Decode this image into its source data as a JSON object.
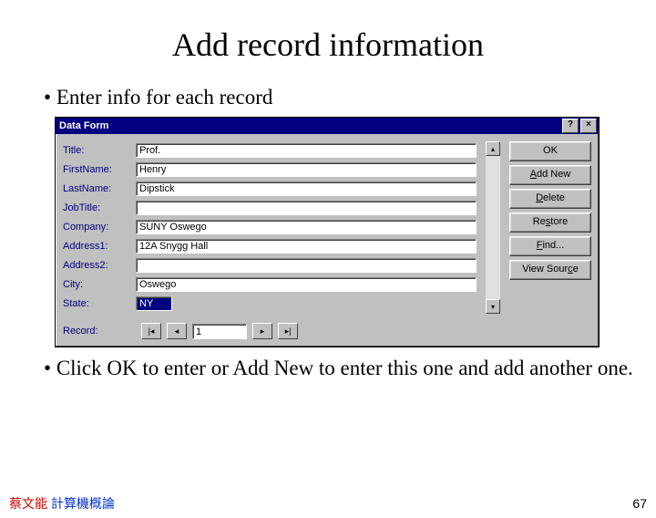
{
  "title": "Add record information",
  "bullet1": "Enter info for each record",
  "bullet2": "Click OK to enter or Add New to enter this one and add another one.",
  "dialog": {
    "title": "Data Form",
    "help": "?",
    "close": "×",
    "labels": {
      "title": "Title:",
      "firstname": "FirstName:",
      "lastname": "LastName:",
      "jobtitle": "JobTitle:",
      "company": "Company:",
      "address1": "Address1:",
      "address2": "Address2:",
      "city": "City:",
      "state": "State:"
    },
    "values": {
      "title": "Prof.",
      "firstname": "Henry",
      "lastname": "Dipstick",
      "jobtitle": "",
      "company": "SUNY Oswego",
      "address1": "12A Snygg Hall",
      "address2": "",
      "city": "Oswego",
      "state": "NY"
    },
    "buttons": {
      "ok": "OK",
      "addnew": "Add New",
      "delete": "Delete",
      "restore": "Restore",
      "find": "Find...",
      "viewsource": "View Source"
    },
    "record": {
      "label": "Record:",
      "value": "1"
    }
  },
  "footer": {
    "author_red": "蔡文能 ",
    "author_blue": "計算機概論"
  },
  "page": "67"
}
